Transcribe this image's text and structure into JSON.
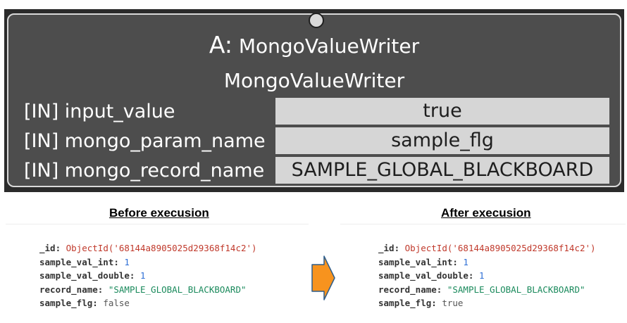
{
  "node": {
    "title_prefix": "A:",
    "title": "MongoValueWriter",
    "subtitle": "MongoValueWriter",
    "ports": [
      {
        "label": "[IN] input_value",
        "value": "true"
      },
      {
        "label": "[IN] mongo_param_name",
        "value": "sample_flg"
      },
      {
        "label": "[IN] mongo_record_name",
        "value": "SAMPLE_GLOBAL_BLACKBOARD"
      }
    ]
  },
  "before": {
    "caption": "Before execusion",
    "record": {
      "id_key": "_id:",
      "id_value": "ObjectId('68144a8905025d29368f14c2')",
      "int_key": "sample_val_int:",
      "int_value": "1",
      "double_key": "sample_val_double:",
      "double_value": "1",
      "name_key": "record_name:",
      "name_value": "\"SAMPLE_GLOBAL_BLACKBOARD\"",
      "flg_key": "sample_flg:",
      "flg_value": "false"
    }
  },
  "after": {
    "caption": "After execusion",
    "record": {
      "id_key": "_id:",
      "id_value": "ObjectId('68144a8905025d29368f14c2')",
      "int_key": "sample_val_int:",
      "int_value": "1",
      "double_key": "sample_val_double:",
      "double_value": "1",
      "name_key": "record_name:",
      "name_value": "\"SAMPLE_GLOBAL_BLACKBOARD\"",
      "flg_key": "sample_flg:",
      "flg_value": "true"
    }
  },
  "colors": {
    "arrow_fill": "#f7931e",
    "arrow_stroke": "#2e5d8a",
    "node_background": "#4d4d4d",
    "port_value_background": "#d6d6d6",
    "objectid": "#c0392b",
    "number": "#2e6fd6",
    "string": "#1a8a5c"
  },
  "icons": {
    "arrow": "right-arrow-icon",
    "port": "connection-port-icon"
  }
}
